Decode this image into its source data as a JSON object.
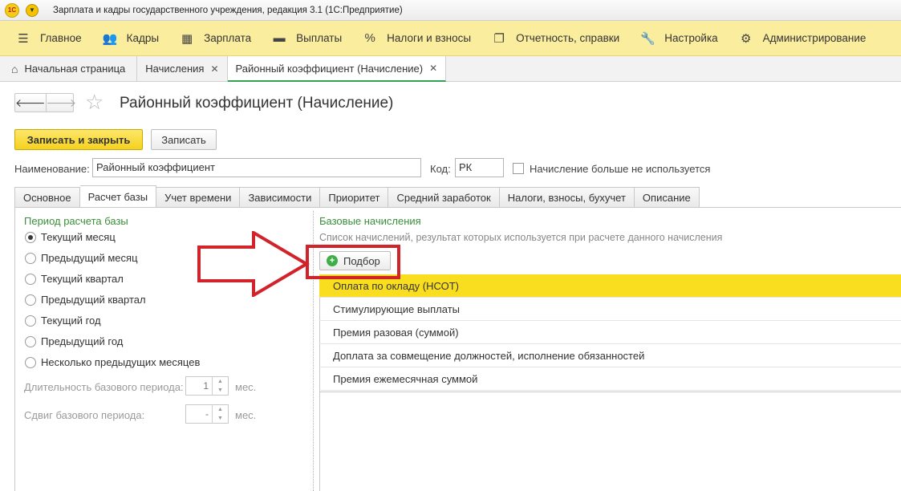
{
  "titlebar": {
    "logo_text": "1С",
    "title": "Зарплата и кадры государственного учреждения, редакция 3.1  (1С:Предприятие)"
  },
  "main_menu": {
    "items": [
      {
        "label": "Главное",
        "icon": "hamburger-icon",
        "glyph": "☰"
      },
      {
        "label": "Кадры",
        "icon": "people-icon",
        "glyph": "👥"
      },
      {
        "label": "Зарплата",
        "icon": "calculator-icon",
        "glyph": "▦"
      },
      {
        "label": "Выплаты",
        "icon": "wallet-icon",
        "glyph": "▬"
      },
      {
        "label": "Налоги и взносы",
        "icon": "percent-icon",
        "glyph": "%"
      },
      {
        "label": "Отчетность, справки",
        "icon": "reports-icon",
        "glyph": "❐"
      },
      {
        "label": "Настройка",
        "icon": "wrench-icon",
        "glyph": "🔧"
      },
      {
        "label": "Администрирование",
        "icon": "gear-icon",
        "glyph": "⚙"
      }
    ]
  },
  "page_tabs": {
    "home": "Начальная страница",
    "tabs": [
      {
        "label": "Начисления"
      },
      {
        "label": "Районный коэффициент (Начисление)"
      }
    ]
  },
  "form": {
    "title": "Районный коэффициент (Начисление)",
    "save_close_label": "Записать и закрыть",
    "save_label": "Записать",
    "name_label": "Наименование:",
    "name_value": "Районный коэффициент",
    "code_label": "Код:",
    "code_value": "РК",
    "unused_label": "Начисление больше не используется"
  },
  "form_tabs": [
    "Основное",
    "Расчет базы",
    "Учет времени",
    "Зависимости",
    "Приоритет",
    "Средний заработок",
    "Налоги, взносы, бухучет",
    "Описание"
  ],
  "base_period": {
    "title": "Период расчета базы",
    "options": [
      "Текущий месяц",
      "Предыдущий месяц",
      "Текущий квартал",
      "Предыдущий квартал",
      "Текущий год",
      "Предыдущий год",
      "Несколько предыдущих месяцев"
    ],
    "selected": 0,
    "duration_label": "Длительность базового периода:",
    "duration_value": "1",
    "shift_label": "Сдвиг базового периода:",
    "shift_value": "-",
    "unit": "мес."
  },
  "base_accruals": {
    "title": "Базовые начисления",
    "hint": "Список начислений, результат которых используется при расчете данного начисления",
    "add_button": "Подбор",
    "items": [
      "Оплата по окладу (НСОТ)",
      "Стимулирующие выплаты",
      "Премия разовая (суммой)",
      "Доплата за совмещение должностей, исполнение обязанностей",
      "Премия ежемесячная суммой"
    ],
    "selected": 0
  },
  "colors": {
    "menu_bg": "#fbed9e",
    "accent_yellow": "#f9dd1f",
    "group_green": "#3a8f3a",
    "annotation_red": "#d2232a"
  }
}
